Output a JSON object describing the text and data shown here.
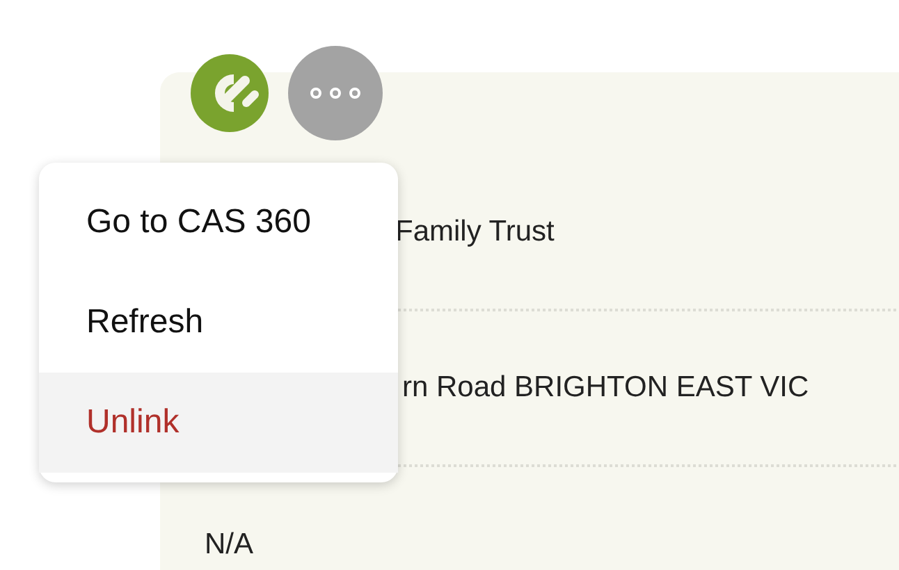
{
  "rows": [
    {
      "text": "Family Trust"
    },
    {
      "text": "rn Road BRIGHTON EAST VIC"
    },
    {
      "text": "N/A"
    }
  ],
  "menu": {
    "items": [
      {
        "label": "Go to CAS 360",
        "kind": "normal",
        "selected": false
      },
      {
        "label": "Refresh",
        "kind": "normal",
        "selected": false
      },
      {
        "label": "Unlink",
        "kind": "danger",
        "selected": true
      }
    ]
  }
}
